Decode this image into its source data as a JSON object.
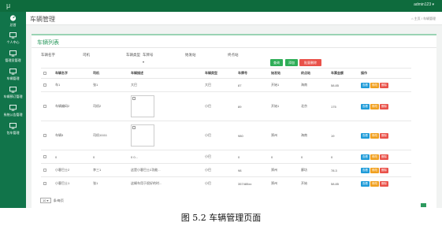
{
  "app": {
    "logo": "μ",
    "user": "admin123 ▾"
  },
  "sidebar": {
    "items": [
      {
        "label": "总首",
        "icon": "dashboard-icon"
      },
      {
        "label": "个人中心",
        "icon": "monitor-icon"
      },
      {
        "label": "管理员管理",
        "icon": "monitor-icon"
      },
      {
        "label": "车辆管理",
        "icon": "monitor-icon"
      },
      {
        "label": "车辆预订管理",
        "icon": "monitor-icon"
      },
      {
        "label": "系统公告管理",
        "icon": "monitor-icon"
      },
      {
        "label": "包车管理",
        "icon": "monitor-icon"
      }
    ]
  },
  "page": {
    "title": "车辆管理",
    "breadcrumb": "⌂ 主页 / 车辆管理"
  },
  "card": {
    "title": "车辆列表",
    "search": {
      "name_label": "车辆名字",
      "driver_label": "司机",
      "type_label": "车辆类型",
      "plate_label": "车牌号",
      "start_label": "始发站",
      "end_label": "终点站"
    },
    "buttons": {
      "search": "查询",
      "add": "添加",
      "batch_delete": "批量删除"
    }
  },
  "table": {
    "headers": [
      "车辆名字",
      "司机",
      "车辆描述",
      "车辆类型",
      "车牌号",
      "始发站",
      "终点站",
      "车票金额",
      "操作"
    ],
    "rows": [
      {
        "name": "车1",
        "driver": "张1",
        "desc": "大巴",
        "type": "大巴",
        "plate": "87",
        "start": "开始1",
        "end": "海南",
        "price": "58.85"
      },
      {
        "name": "车辆编码2",
        "driver": "司机2",
        "desc": "",
        "type": "小巴",
        "plate": "89",
        "start": "开始1",
        "end": "北京",
        "price": "175"
      },
      {
        "name": "车辆5",
        "driver": "司机11111",
        "desc": "",
        "type": "小巴",
        "plate": "980",
        "start": "郑州",
        "end": "海南",
        "price": "19"
      },
      {
        "name": "0",
        "driver": "0",
        "desc": "0 0...",
        "type": "小巴",
        "plate": "0",
        "start": "0",
        "end": "0",
        "price": "0"
      },
      {
        "name": "小客巴士2",
        "driver": "李三1",
        "desc": "这是小客巴士2功能...",
        "type": "小巴",
        "plate": "98",
        "start": "郑州",
        "end": "廊坊",
        "price": "78.3"
      },
      {
        "name": "小客巴士1",
        "driver": "张1",
        "desc": "这辆车用于很好的时...",
        "type": "小巴",
        "plate": "357485xx",
        "start": "郑州",
        "end": "开始",
        "price": "58.85"
      }
    ],
    "actions": {
      "view": "查看",
      "edit": "修改",
      "delete": "删除"
    }
  },
  "footer": {
    "page_size": "10 ▾",
    "per_page_label": "条/每页"
  },
  "caption": "图 5.2  车辆管理页面"
}
